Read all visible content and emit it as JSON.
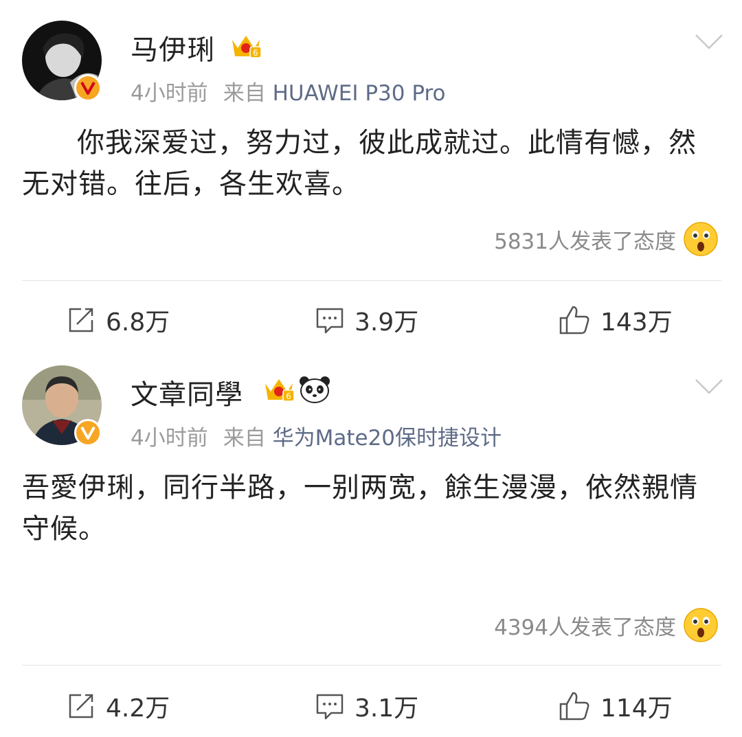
{
  "posts": [
    {
      "username": "马伊琍",
      "time": "4小时前",
      "from_label": "来自",
      "source": "HUAWEI P30 Pro",
      "content": "你我深爱过，努力过，彼此成就过。此情有憾，然无对错。往后，各生欢喜。",
      "reactions_text": "5831人发表了态度",
      "repost_count": "6.8万",
      "comment_count": "3.9万",
      "like_count": "143万",
      "badges": [
        "crown-vip-icon"
      ]
    },
    {
      "username": "文章同學",
      "time": "4小时前",
      "from_label": "来自",
      "source": "华为Mate20保时捷设计",
      "content": "吾愛伊琍，同行半路，一别两宽，餘生漫漫，依然親情守候。",
      "reactions_text": "4394人发表了态度",
      "repost_count": "4.2万",
      "comment_count": "3.1万",
      "like_count": "114万",
      "badges": [
        "crown-vip-icon",
        "panda-icon"
      ]
    }
  ],
  "colors": {
    "source_link": "#5e6b87",
    "meta": "#9b9b9b",
    "verified": "#f6a623",
    "crown": "#f5b400",
    "divider": "#e3e3e3"
  }
}
